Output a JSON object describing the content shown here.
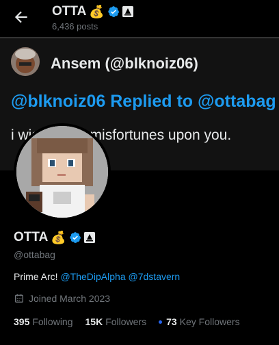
{
  "header": {
    "name": "OTTA",
    "emoji": "💰",
    "posts": "6,436 posts"
  },
  "banner": {
    "quoted_user": "Ansem (@blknoiz06)",
    "reply_line": "@blknoiz06 Replied to @ottabag",
    "text": "i wish many misfortunes upon you."
  },
  "profile": {
    "name": "OTTA",
    "emoji": "💰",
    "handle": "@ottabag",
    "bio_prefix": "Prime Arc! ",
    "bio_link1": "@TheDipAlpha",
    "bio_link2": "@7dstavern",
    "joined": "Joined March 2023"
  },
  "stats": {
    "following_count": "395",
    "following_label": "Following",
    "followers_count": "15K",
    "followers_label": "Followers",
    "key_count": "73",
    "key_label": "Key Followers"
  },
  "colors": {
    "accent": "#1d9bf0",
    "muted": "#71767b",
    "text": "#e7e9ea",
    "background": "#000000"
  }
}
